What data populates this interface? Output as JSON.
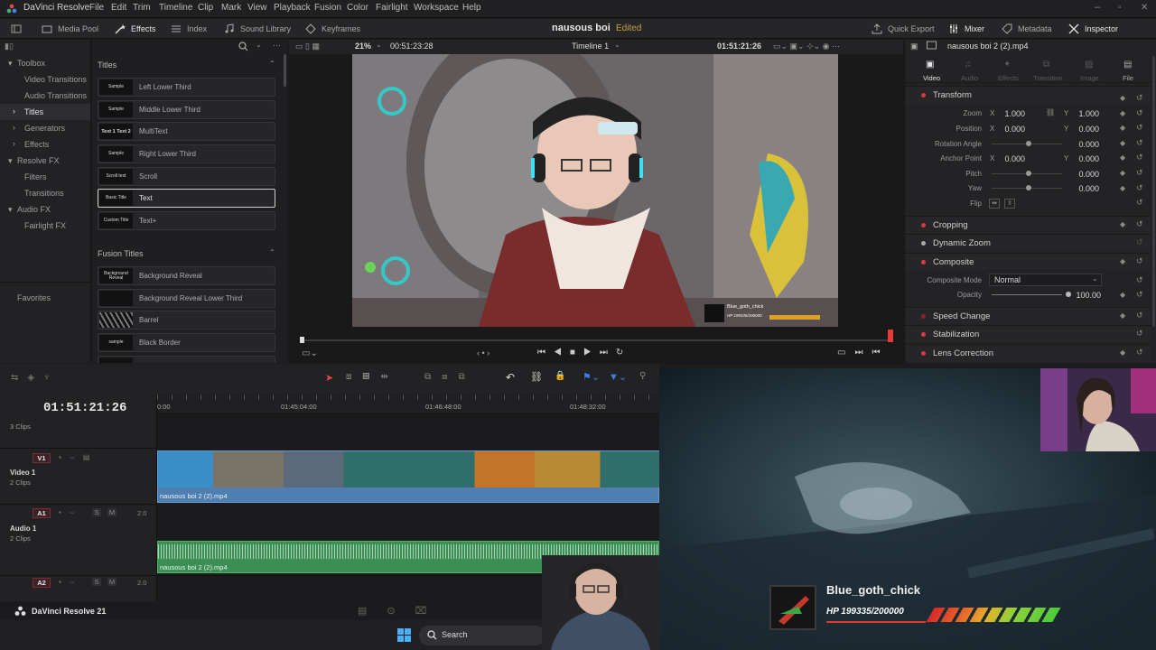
{
  "app": {
    "title": "DaVinci Resolve",
    "footer": "DaVinci Resolve 21"
  },
  "menu": [
    "File",
    "Edit",
    "Trim",
    "Timeline",
    "Clip",
    "Mark",
    "View",
    "Playback",
    "Fusion",
    "Color",
    "Fairlight",
    "Workspace",
    "Help"
  ],
  "toolbar": {
    "media_pool": "Media Pool",
    "effects": "Effects",
    "index": "Index",
    "sound_library": "Sound Library",
    "keyframes": "Keyframes",
    "project": "nausous boi",
    "status": "Edited",
    "quick_export": "Quick Export",
    "mixer": "Mixer",
    "metadata": "Metadata",
    "inspector": "Inspector"
  },
  "toolbox": {
    "items": [
      {
        "label": "Toolbox"
      },
      {
        "label": "Video Transitions"
      },
      {
        "label": "Audio Transitions"
      },
      {
        "label": "Titles"
      },
      {
        "label": "Generators"
      },
      {
        "label": "Effects"
      },
      {
        "label": "Resolve FX"
      },
      {
        "label": "Filters"
      },
      {
        "label": "Transitions"
      },
      {
        "label": "Audio FX"
      },
      {
        "label": "Fairlight FX"
      }
    ],
    "favorites": "Favorites"
  },
  "effects": {
    "titles_header": "Titles",
    "titles": [
      {
        "label": "Left Lower Third",
        "thumb": "Sample"
      },
      {
        "label": "Middle Lower Third",
        "thumb": "Sample"
      },
      {
        "label": "MultiText",
        "thumb": "Text 1 Text 2"
      },
      {
        "label": "Right Lower Third",
        "thumb": "Sample"
      },
      {
        "label": "Scroll",
        "thumb": "Scroll text"
      },
      {
        "label": "Text",
        "thumb": "Basic Title"
      },
      {
        "label": "Text+",
        "thumb": "Custom Title"
      }
    ],
    "fusion_header": "Fusion Titles",
    "fusion": [
      {
        "label": "Background Reveal",
        "thumb": "Background Reveal"
      },
      {
        "label": "Background Reveal Lower Third",
        "thumb": ""
      },
      {
        "label": "Barrel",
        "thumb": ""
      },
      {
        "label": "Black Border",
        "thumb": "sample"
      }
    ]
  },
  "viewer": {
    "zoom": "21%",
    "source_tc": "00:51:23:28",
    "timeline": "Timeline 1",
    "record_tc": "01:51:21:26",
    "overlay_name": "Blue_goth_chick",
    "overlay_hp": "HP 199335/200000"
  },
  "inspector": {
    "clip": "nausous boi 2 (2).mp4",
    "tabs": [
      "Video",
      "Audio",
      "Effects",
      "Transition",
      "Image",
      "File"
    ],
    "transform": "Transform",
    "zoom": {
      "label": "Zoom",
      "x": "1.000",
      "y": "1.000"
    },
    "position": {
      "label": "Position",
      "x": "0.000",
      "y": "0.000"
    },
    "rotation": {
      "label": "Rotation Angle",
      "value": "0.000"
    },
    "anchor": {
      "label": "Anchor Point",
      "x": "0.000",
      "y": "0.000"
    },
    "pitch": {
      "label": "Pitch",
      "value": "0.000"
    },
    "yaw": {
      "label": "Yaw",
      "value": "0.000"
    },
    "flip": "Flip",
    "axis_x": "X",
    "axis_y": "Y",
    "cropping": "Cropping",
    "dynamic_zoom": "Dynamic Zoom",
    "composite": "Composite",
    "composite_mode": {
      "label": "Composite Mode",
      "value": "Normal"
    },
    "opacity": {
      "label": "Opacity",
      "value": "100.00"
    },
    "speed_change": "Speed Change",
    "stabilization": "Stabilization",
    "lens_correction": "Lens Correction"
  },
  "timeline": {
    "timecode": "01:51:21:26",
    "ruler": [
      "0:00",
      "01:45:04:00",
      "01:46:48:00",
      "01:48:32:00"
    ],
    "tracks": {
      "top_clips": "3 Clips",
      "v1": {
        "badge": "V1",
        "name": "Video 1",
        "clips": "2 Clips",
        "clip_name": "nausous boi 2 (2).mp4"
      },
      "a1": {
        "badge": "A1",
        "name": "Audio 1",
        "clips": "2 Clips",
        "level": "2.0",
        "clip_name": "nausous boi 2 (2).mp4",
        "s": "S",
        "m": "M"
      },
      "a2": {
        "badge": "A2",
        "level": "2.0",
        "s": "S",
        "m": "M"
      }
    }
  },
  "taskbar": {
    "search": "Search"
  },
  "stream_overlay": {
    "name": "Blue_goth_chick",
    "hp": "HP 199335/200000"
  },
  "colors": {
    "accent_red": "#d8384a",
    "edited": "#c9a040",
    "video_clip": "#5a88b8",
    "audio_clip": "#3f9e5a"
  }
}
